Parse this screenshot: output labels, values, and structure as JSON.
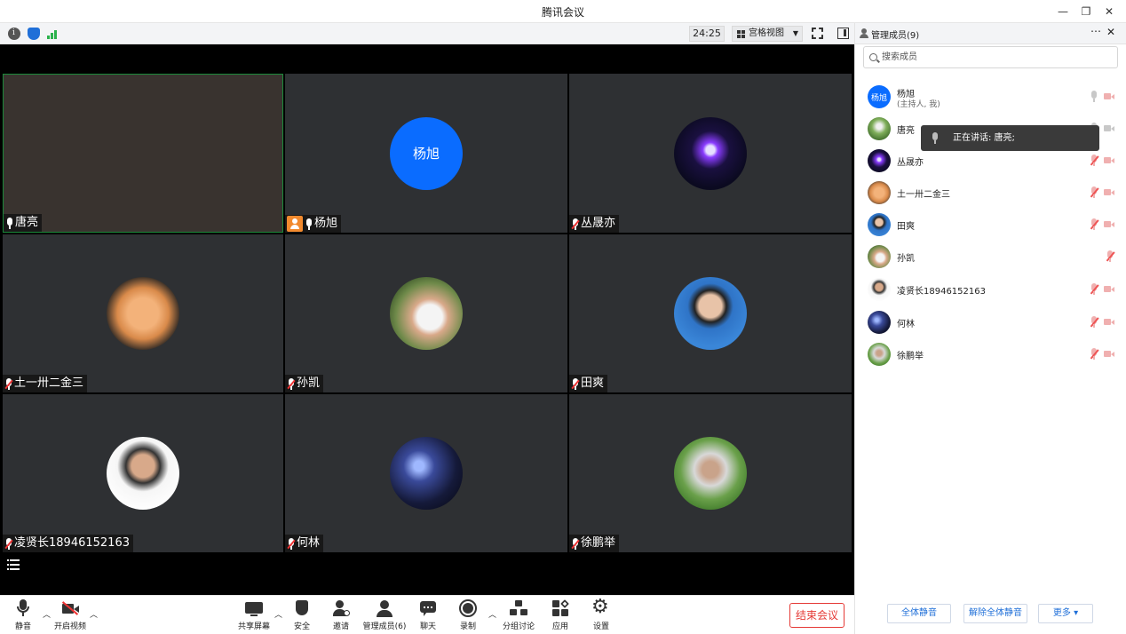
{
  "window": {
    "title": "腾讯会议"
  },
  "toolbar_top": {
    "timer": "24:25",
    "view_label": "宫格视图"
  },
  "tiles": [
    {
      "name": "唐亮",
      "mic": "on",
      "host": false
    },
    {
      "name": "杨旭",
      "mic": "on",
      "host": true,
      "avatar_text": "杨旭"
    },
    {
      "name": "丛晟亦",
      "mic": "off",
      "host": false
    },
    {
      "name": "土一卅二金三",
      "mic": "off",
      "host": false
    },
    {
      "name": "孙凯",
      "mic": "off",
      "host": false
    },
    {
      "name": "田爽",
      "mic": "off",
      "host": false
    },
    {
      "name": "凌贤长18946152163",
      "mic": "off",
      "host": false
    },
    {
      "name": "何林",
      "mic": "off",
      "host": false
    },
    {
      "name": "徐鹏举",
      "mic": "off",
      "host": false
    }
  ],
  "bottom_toolbar": {
    "mute": "静音",
    "video": "开启视频",
    "share": "共享屏幕",
    "security": "安全",
    "invite": "邀请",
    "members": "管理成员(6)",
    "chat": "聊天",
    "record": "录制",
    "breakout": "分组讨论",
    "apps": "应用",
    "settings": "设置",
    "end": "结束会议"
  },
  "panel": {
    "title": "管理成员(9)",
    "search_placeholder": "搜索成员",
    "tooltip": "正在讲话: 唐亮;",
    "members": [
      {
        "name": "杨旭",
        "sub": "(主持人, 我)",
        "avatar_text": "杨旭"
      },
      {
        "name": "唐亮"
      },
      {
        "name": "丛晟亦"
      },
      {
        "name": "土一卅二金三"
      },
      {
        "name": "田爽"
      },
      {
        "name": "孙凯"
      },
      {
        "name": "凌贤长18946152163"
      },
      {
        "name": "何林"
      },
      {
        "name": "徐鹏举"
      }
    ],
    "mute_all": "全体静音",
    "unmute_all": "解除全体静音",
    "more": "更多 ▾"
  },
  "colors": {
    "accent": "#0a6cff",
    "danger": "#e53935",
    "tile_bg": "#2e3033"
  }
}
